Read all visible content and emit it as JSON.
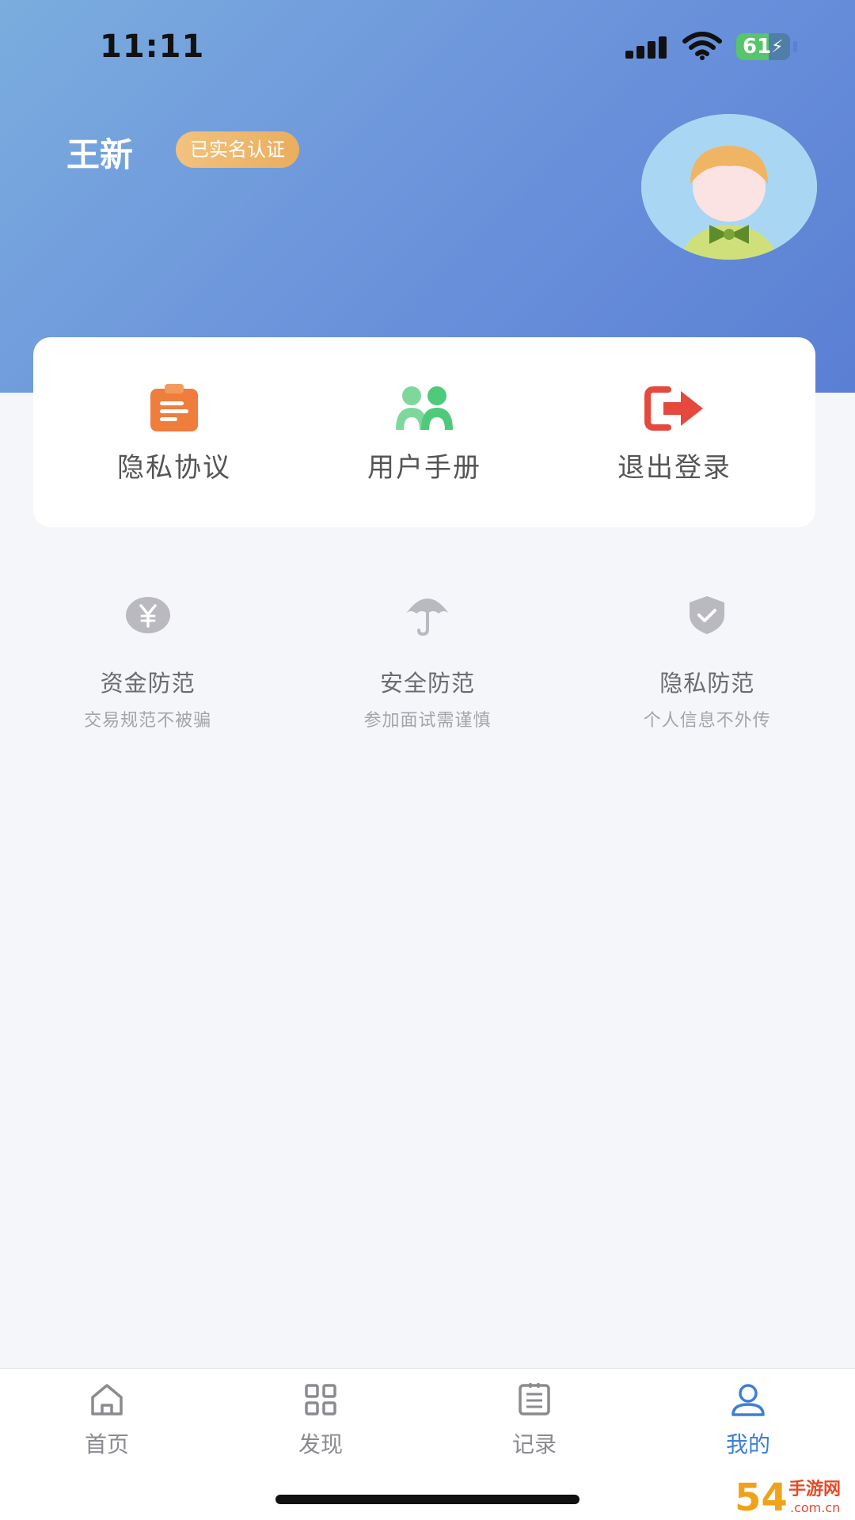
{
  "status_bar": {
    "time": "11:11",
    "battery_level": "61",
    "battery_fraction": 0.61,
    "battery_color": "#58c46b"
  },
  "profile": {
    "name": "王新",
    "verify_badge": "已实名认证",
    "avatar_icon": "cartoon-avatar-icon"
  },
  "colors": {
    "header_gradient_start": "#7badde",
    "header_gradient_end": "#5a7fd4",
    "accent": "#3d7fd6",
    "badge": "#efbb74"
  },
  "menu": [
    {
      "label": "隐私协议",
      "icon": "clipboard-document-icon",
      "color": "#ef7d3c"
    },
    {
      "label": "用户手册",
      "icon": "users-group-icon",
      "color": "#4fc97a"
    },
    {
      "label": "退出登录",
      "icon": "logout-arrow-icon",
      "color": "#e5483d"
    }
  ],
  "tips": [
    {
      "title": "资金防范",
      "subtitle": "交易规范不被骗",
      "icon": "yen-coin-icon"
    },
    {
      "title": "安全防范",
      "subtitle": "参加面试需谨慎",
      "icon": "umbrella-icon"
    },
    {
      "title": "隐私防范",
      "subtitle": "个人信息不外传",
      "icon": "shield-check-icon"
    }
  ],
  "tabs": [
    {
      "label": "首页",
      "icon": "home-icon",
      "active": false
    },
    {
      "label": "发现",
      "icon": "grid-icon",
      "active": false
    },
    {
      "label": "记录",
      "icon": "list-document-icon",
      "active": false
    },
    {
      "label": "我的",
      "icon": "user-icon",
      "active": true
    }
  ],
  "watermark": {
    "brand": "54",
    "text": "手游网",
    "domain": ".com.cn"
  }
}
